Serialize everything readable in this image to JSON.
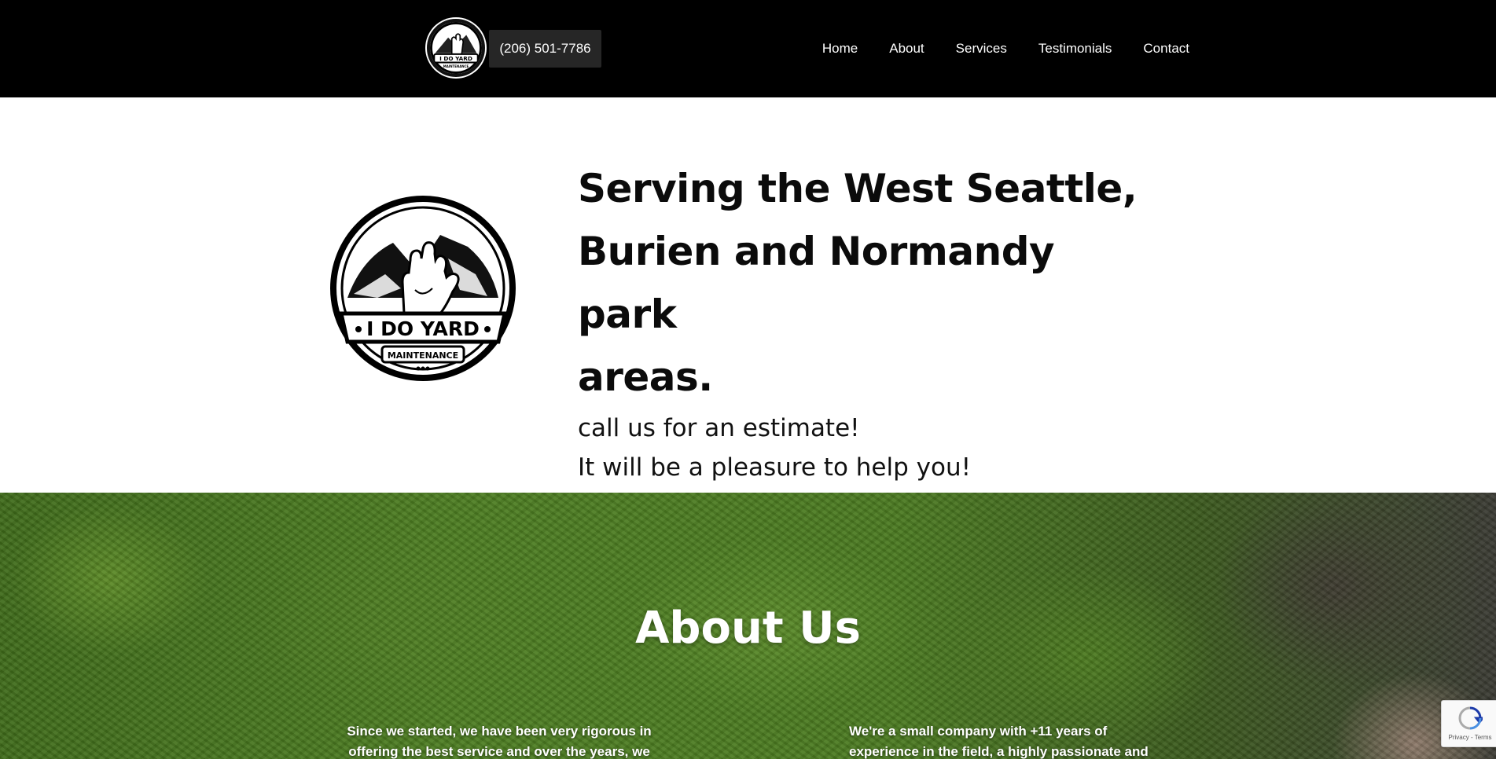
{
  "header": {
    "phone": "(206) 501-7786",
    "nav": [
      "Home",
      "About",
      "Services",
      "Testimonials",
      "Contact"
    ],
    "logo": {
      "line1": "I DO YARD",
      "line2": "MAINTENANCE"
    }
  },
  "hero": {
    "headline_lines": [
      "Serving the West Seattle,",
      "Burien and Normandy park",
      "areas."
    ],
    "sub_lines": [
      "call us for an estimate!",
      "It will be a pleasure to help you!"
    ],
    "logo": {
      "line1": "I DO YARD",
      "line2": "MAINTENANCE"
    }
  },
  "about": {
    "title": "About Us",
    "left_lines": [
      "Since we started, we have been very rigorous in",
      "offering the best service and over the years, we"
    ],
    "right_lines": [
      "We're a small company with +11 years of",
      "experience in the field, a highly passionate and"
    ]
  },
  "recaptcha": {
    "text": "Privacy - Terms"
  },
  "colors": {
    "header_bg": "#000000",
    "phone_bg": "#262626",
    "text_dark": "#0b0b0b"
  }
}
